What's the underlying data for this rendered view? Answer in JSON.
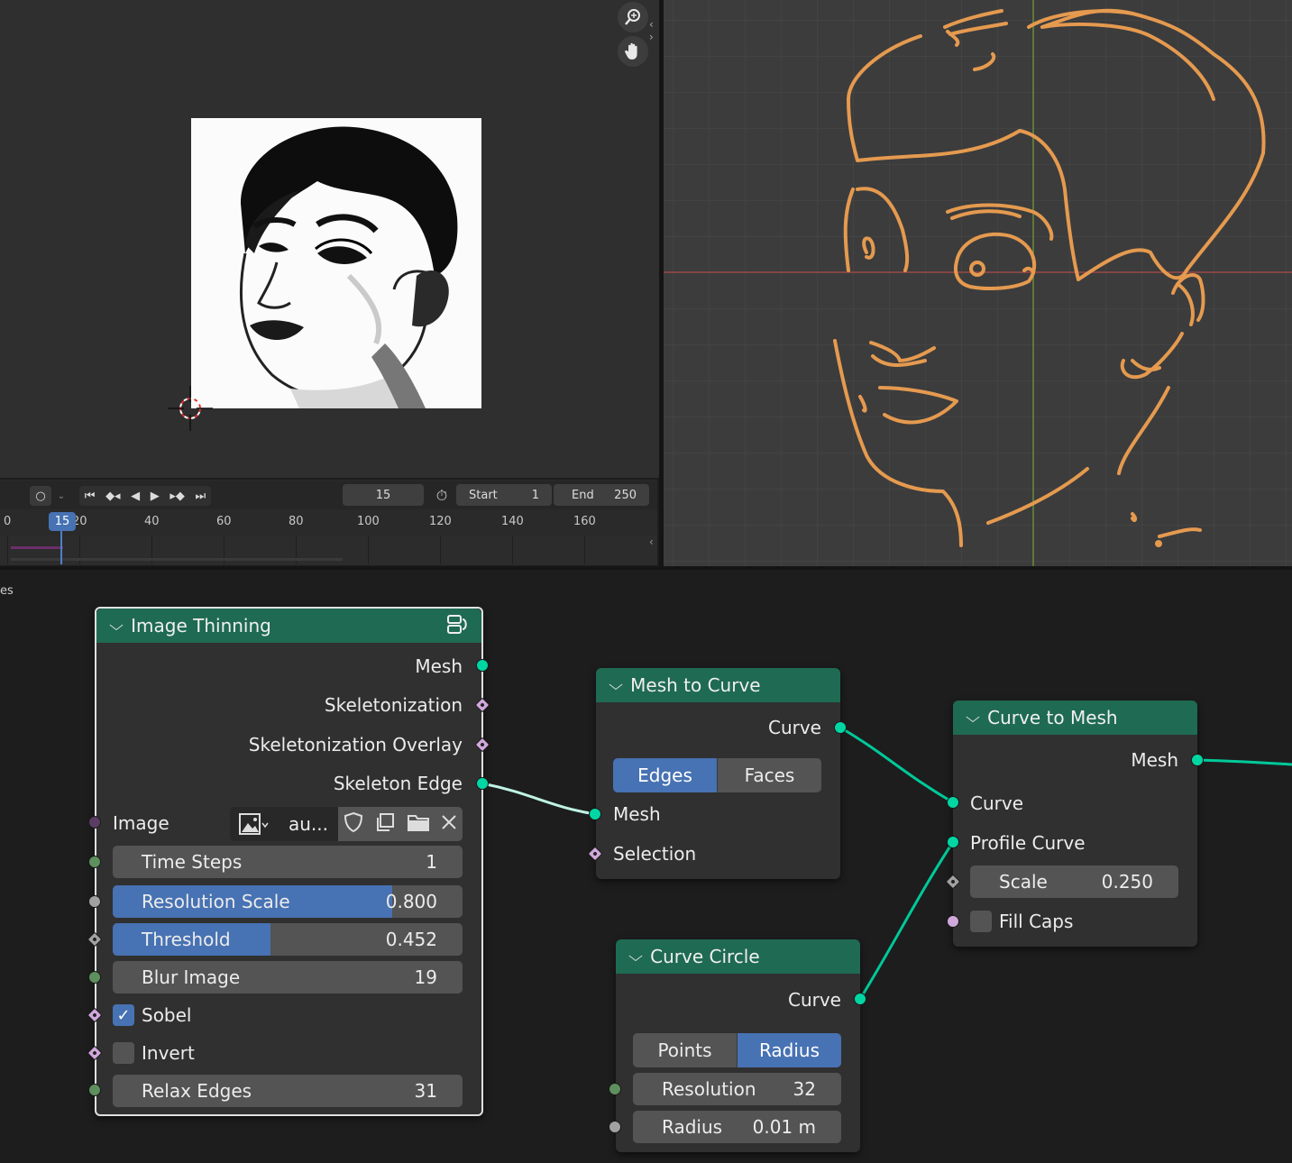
{
  "image_editor": {
    "zoom_icon": "magnifier-plus-icon",
    "pan_icon": "hand-icon"
  },
  "timeline": {
    "current_frame": "15",
    "start_label": "Start",
    "start_value": "1",
    "end_label": "End",
    "end_value": "250",
    "playhead_label": "15",
    "ticks": [
      "0",
      "20",
      "40",
      "60",
      "80",
      "100",
      "120",
      "140",
      "160"
    ]
  },
  "node_editor": {
    "side_label": "es",
    "image_thinning": {
      "title": "Image Thinning",
      "outputs": [
        "Mesh",
        "Skeletonization",
        "Skeletonization Overlay",
        "Skeleton Edge"
      ],
      "image_label": "Image",
      "image_name": "au...",
      "time_steps": {
        "label": "Time Steps",
        "value": "1"
      },
      "resolution_scale": {
        "label": "Resolution Scale",
        "value": "0.800",
        "fill": 0.8
      },
      "threshold": {
        "label": "Threshold",
        "value": "0.452",
        "fill": 0.452
      },
      "blur_image": {
        "label": "Blur Image",
        "value": "19"
      },
      "sobel": {
        "label": "Sobel",
        "checked": true
      },
      "invert": {
        "label": "Invert",
        "checked": false
      },
      "relax_edges": {
        "label": "Relax Edges",
        "value": "31"
      }
    },
    "mesh_to_curve": {
      "title": "Mesh to Curve",
      "output": "Curve",
      "mode_options": [
        "Edges",
        "Faces"
      ],
      "mode_selected": "Edges",
      "inputs": [
        "Mesh",
        "Selection"
      ]
    },
    "curve_to_mesh": {
      "title": "Curve to Mesh",
      "output": "Mesh",
      "inputs": [
        "Curve",
        "Profile Curve"
      ],
      "scale": {
        "label": "Scale",
        "value": "0.250"
      },
      "fill_caps": {
        "label": "Fill Caps",
        "checked": false
      }
    },
    "curve_circle": {
      "title": "Curve Circle",
      "output": "Curve",
      "mode_options": [
        "Points",
        "Radius"
      ],
      "mode_selected": "Radius",
      "resolution": {
        "label": "Resolution",
        "value": "32"
      },
      "radius": {
        "label": "Radius",
        "value": "0.01 m"
      }
    }
  },
  "colors": {
    "node_header": "#1f6a52",
    "geometry_socket": "#00d6a3",
    "selected_blue": "#4772b3",
    "curve_stroke": "#e59a4f"
  }
}
